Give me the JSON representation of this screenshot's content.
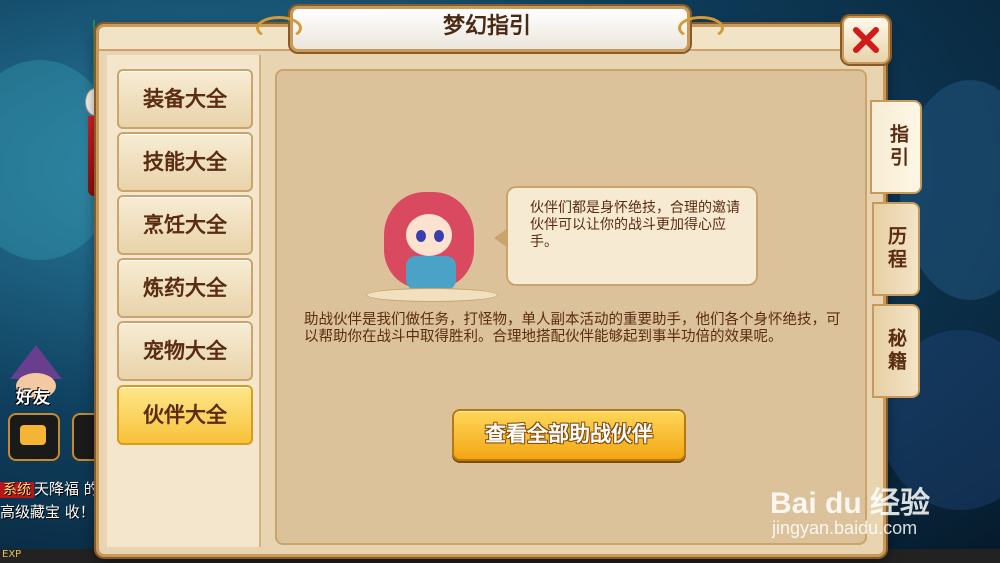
{
  "title": "梦幻指引",
  "close_icon": "close-x-icon",
  "sidebar": {
    "items": [
      {
        "label": "装备大全",
        "active": false
      },
      {
        "label": "技能大全",
        "active": false
      },
      {
        "label": "烹饪大全",
        "active": false
      },
      {
        "label": "炼药大全",
        "active": false
      },
      {
        "label": "宠物大全",
        "active": false
      },
      {
        "label": "伙伴大全",
        "active": true
      }
    ]
  },
  "right_tabs": [
    {
      "label": "指引",
      "active": true
    },
    {
      "label": "历程",
      "active": false
    },
    {
      "label": "秘籍",
      "active": false
    }
  ],
  "bubble_text": "伙伴们都是身怀绝技，合理的邀请伙伴可以让你的战斗更加得心应手。",
  "description": "助战伙伴是我们做任务，打怪物，单人副本活动的重要助手，他们各个身怀绝技，可以帮助你在战斗中取得胜利。合理地搭配伙伴能够起到事半功倍的效果呢。",
  "view_button_label": "查看全部助战伙伴",
  "hud": {
    "friend_label": "好友",
    "system_tag": "系统",
    "system_message": "天降福 的高级藏宝 收！",
    "exp_label": "EXP"
  },
  "watermark": {
    "logo": "Bai du 经验",
    "url": "jingyan.baidu.com"
  },
  "colors": {
    "accent_gold": "#f2a614",
    "active_tab": "#f7c23a",
    "panel": "#e8d4b0",
    "text_brown": "#5a2c12"
  }
}
